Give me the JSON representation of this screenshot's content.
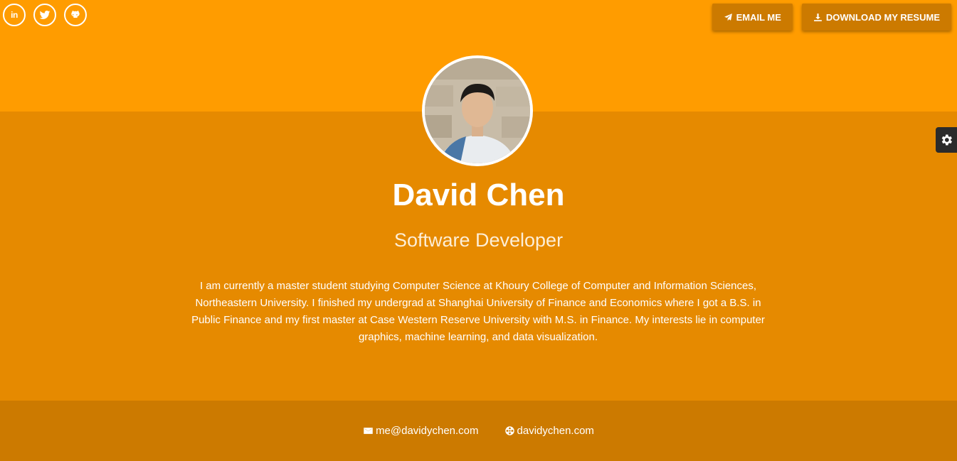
{
  "header": {
    "social_links": [
      {
        "name": "linkedin",
        "label": "in"
      },
      {
        "name": "twitter"
      },
      {
        "name": "github"
      }
    ],
    "email_button": {
      "label": "EMAIL ME",
      "icon": "paper-plane-icon"
    },
    "resume_button": {
      "label": "DOWNLOAD MY RESUME",
      "icon": "download-icon"
    }
  },
  "profile": {
    "name": "David Chen",
    "title": "Software Developer",
    "bio": "I am currently a master student studying Computer Science at Khoury College of Computer and Information Sciences, Northeastern University. I finished my undergrad at Shanghai University of Finance and Economics where I got a B.S. in Public Finance and my first master at Case Western Reserve University with M.S. in Finance. My interests lie in computer graphics, machine learning, and data visualization."
  },
  "footer": {
    "email": "me@davidychen.com",
    "website": "davidychen.com"
  },
  "colors": {
    "top_band": "#ff9c00",
    "main_band": "#e68a00",
    "footer_band": "#cc7a00",
    "button_bg": "#cc7a00",
    "settings_tab": "#2b2b2b"
  }
}
